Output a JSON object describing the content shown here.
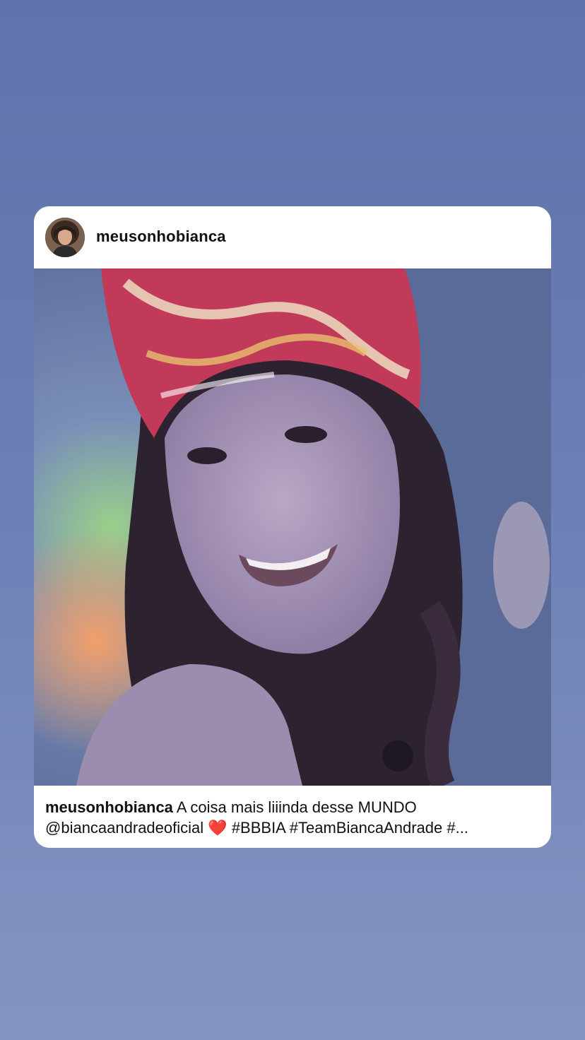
{
  "post": {
    "username": "meusonhobianca",
    "avatar_icon": "profile-photo",
    "photo_icon": "woman-bandana-photo",
    "caption": {
      "username": "meusonhobianca",
      "text": " A coisa mais liiinda desse MUNDO",
      "mention": "@biancaandradeoficial",
      "emoji": "❤️",
      "hashtags": "#BBBIA #TeamBiancaAndrade #..."
    }
  },
  "colors": {
    "background_top": "#5f72ac",
    "background_bottom": "#8494c3",
    "card": "#ffffff",
    "text": "#111111"
  }
}
